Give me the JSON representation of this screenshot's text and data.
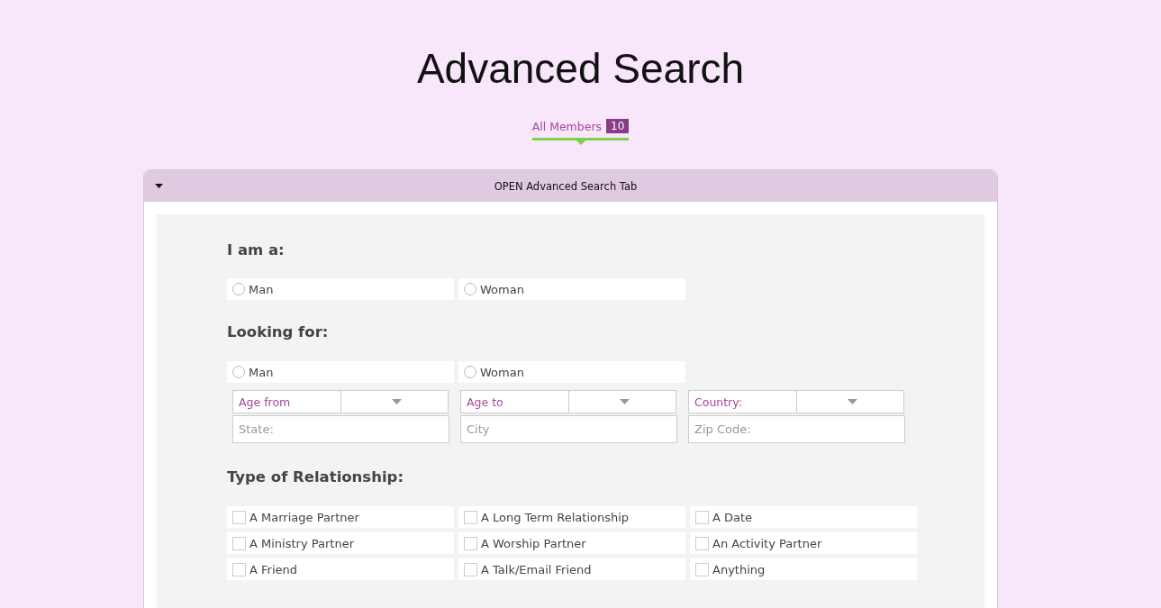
{
  "title": "Advanced Search",
  "tabs": [
    {
      "label": "All Members",
      "count": "10",
      "selected": true
    }
  ],
  "panel": {
    "header": "OPEN Advanced Search Tab",
    "expanded": true
  },
  "i_am": {
    "heading": "I am a:",
    "options": [
      {
        "label": "Man",
        "selected": false
      },
      {
        "label": "Woman",
        "selected": false
      }
    ]
  },
  "looking_for": {
    "heading": "Looking for:",
    "options": [
      {
        "label": "Man",
        "selected": false
      },
      {
        "label": "Woman",
        "selected": false
      }
    ]
  },
  "dropdowns": [
    {
      "label": "Age from"
    },
    {
      "label": "Age to"
    },
    {
      "label": "Country:"
    }
  ],
  "fields": [
    {
      "placeholder": "State:"
    },
    {
      "placeholder": "City"
    },
    {
      "placeholder": "Zip Code:"
    }
  ],
  "relationship": {
    "heading": "Type of Relationship:",
    "options": [
      {
        "label": "A Marriage Partner",
        "checked": false
      },
      {
        "label": "A Long Term Relationship",
        "checked": false
      },
      {
        "label": "A Date",
        "checked": false
      },
      {
        "label": "A Ministry Partner",
        "checked": false
      },
      {
        "label": "A Worship Partner",
        "checked": false
      },
      {
        "label": "An Activity Partner",
        "checked": false
      },
      {
        "label": "A Friend",
        "checked": false
      },
      {
        "label": "A Talk/Email Friend",
        "checked": false
      },
      {
        "label": "Anything",
        "checked": false
      }
    ]
  }
}
